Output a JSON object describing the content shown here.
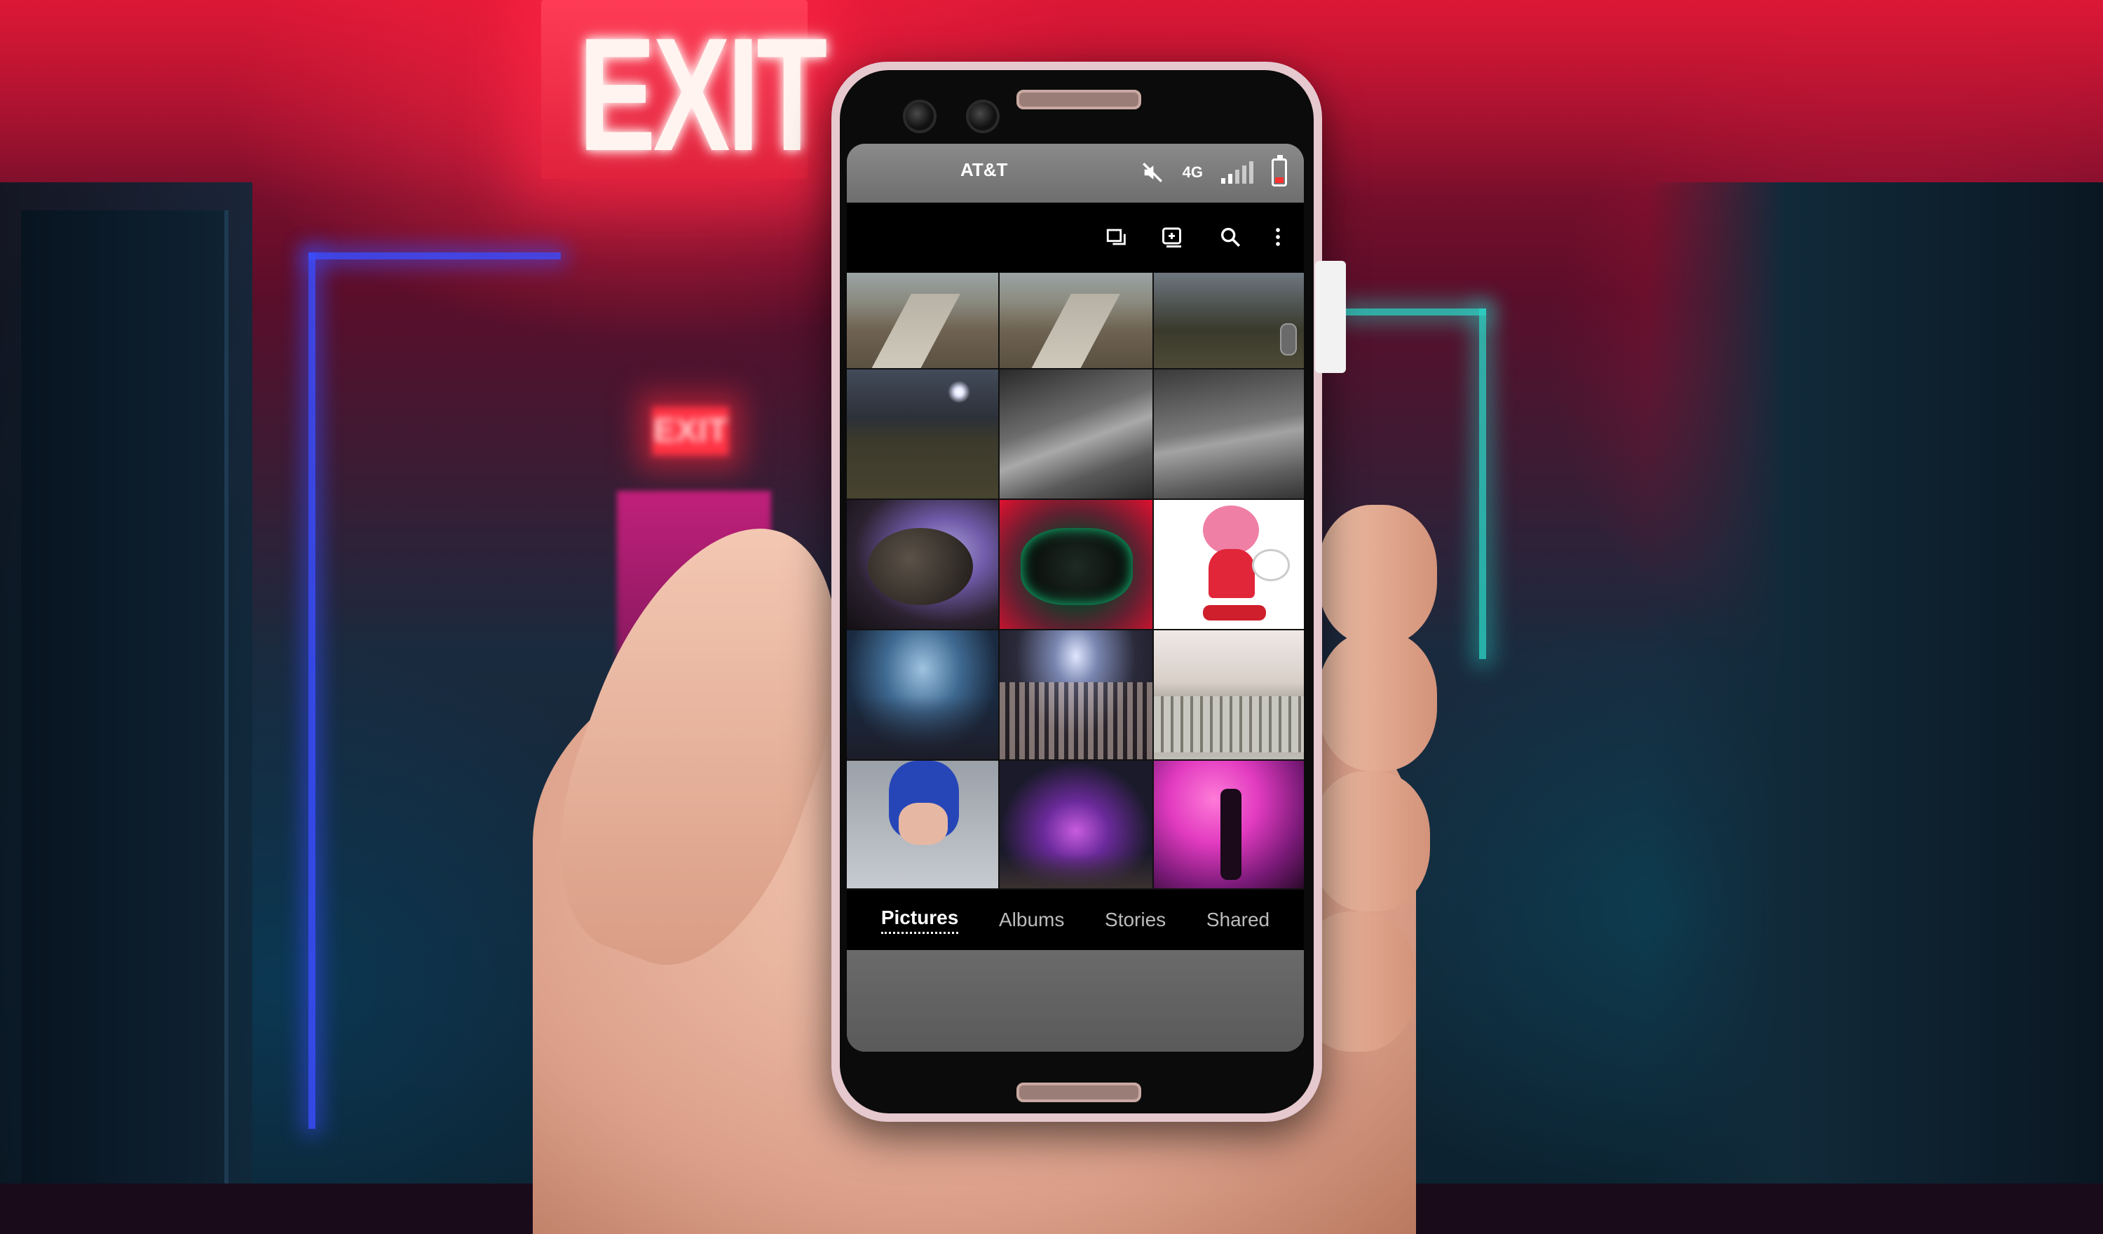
{
  "backdrop": {
    "exit_sign_text": "EXIT",
    "far_exit_text": "EXIT"
  },
  "status_bar": {
    "carrier": "AT&T",
    "network": "4G",
    "icons": [
      "mute-icon",
      "signal-icon",
      "battery-icon"
    ],
    "battery_color": "#ff3030"
  },
  "toolbar": {
    "icons": [
      "select-icon",
      "add-album-icon",
      "search-icon",
      "more-vert-icon"
    ]
  },
  "gallery": {
    "tiles": [
      "sidewalk-photo",
      "sidewalk-photo",
      "field-at-night-photo",
      "moon-over-field-photo",
      "curb-photo",
      "curb-photo",
      "guitar-photo",
      "red-green-graffiti-photo",
      "amy-rose-character-image",
      "concert-crowd-photo",
      "concert-crowd-photo",
      "cans-on-table-photo",
      "blue-hair-costume-photo",
      "concert-stage-photo",
      "performer-pink-light-photo"
    ]
  },
  "tabs": {
    "items": [
      {
        "label": "Pictures",
        "active": true
      },
      {
        "label": "Albums",
        "active": false
      },
      {
        "label": "Stories",
        "active": false
      },
      {
        "label": "Shared",
        "active": false
      }
    ]
  }
}
